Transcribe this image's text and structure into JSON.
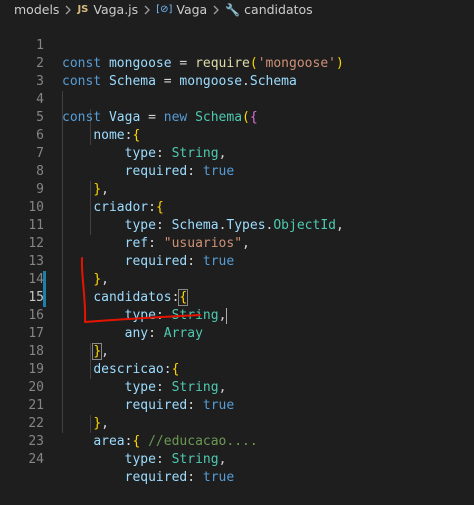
{
  "breadcrumb": {
    "folder": "models",
    "file_badge": "JS",
    "file": "Vaga.js",
    "symbol1": "Vaga",
    "symbol2": "candidatos"
  },
  "lines": {
    "n1": "1",
    "n2": "2",
    "n3": "3",
    "n4": "4",
    "n5": "5",
    "n6": "6",
    "n7": "7",
    "n8": "8",
    "n9": "9",
    "n10": "10",
    "n11": "11",
    "n12": "12",
    "n13": "13",
    "n14": "14",
    "n15": "15",
    "n16": "16",
    "n17": "17",
    "n18": "18",
    "n19": "19",
    "n20": "20",
    "n21": "21",
    "n22": "22",
    "n23": "23",
    "n24": "24"
  },
  "tokens": {
    "const": "const",
    "new": "new",
    "true": "true",
    "mongoose": "mongoose",
    "Schema": "Schema",
    "Vaga": "Vaga",
    "require": "require",
    "mongoose_str": "'mongoose'",
    "nome": "nome",
    "type": "type",
    "String": "String",
    "required": "required",
    "criador": "criador",
    "Types": "Types",
    "ObjectId": "ObjectId",
    "ref": "ref",
    "usuarios_str": "\"usuarios\"",
    "candidatos": "candidatos",
    "any": "any",
    "Array": "Array",
    "descricao": "descricao",
    "area": "area",
    "comment": "//educacao...."
  },
  "colors": {
    "keyword": "#569cd6",
    "variable": "#9cdcfe",
    "class": "#4ec9b0",
    "function": "#dcdcaa",
    "string": "#ce9178",
    "comment": "#6a9955",
    "annotation": "#e51400",
    "modified_bar": "#1b81a8"
  }
}
